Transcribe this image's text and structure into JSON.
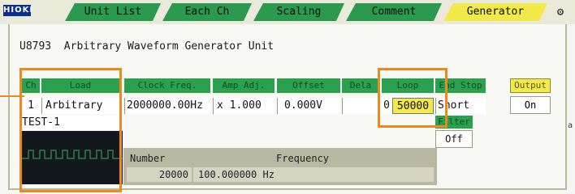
{
  "tabs": {
    "logo": "HIOKI",
    "items": [
      {
        "label": "Unit List"
      },
      {
        "label": "Each Ch"
      },
      {
        "label": "Scaling"
      },
      {
        "label": "Comment"
      },
      {
        "label": "Generator",
        "active": true
      }
    ],
    "icon": "settings-icon"
  },
  "unit_title": "U8793  Arbitrary Waveform Generator Unit",
  "channel_table": {
    "headers": {
      "ch": "Ch",
      "load": "Load",
      "clock_freq": "Clock Freq.",
      "amp_adj": "Amp Adj.",
      "offset": "Offset",
      "delay": "Dela",
      "loop": "Loop",
      "end_stop": "End Stop"
    },
    "row": {
      "ch": "1",
      "load": "Arbitrary",
      "clock_freq": "2000000.00Hz",
      "amp_adj": "x 1.000",
      "offset": "0.000V",
      "delay": "",
      "loop_prefix": "0",
      "loop": "50000",
      "end_stop": "Short"
    },
    "file_name": "TEST-1"
  },
  "filter": {
    "label": "Filter",
    "value": "Off"
  },
  "output": {
    "label": "Output",
    "value": "On"
  },
  "freq_table": {
    "headers": {
      "number": "Number",
      "frequency": "Frequency"
    },
    "row": {
      "number": "20000",
      "frequency": "100.000000 Hz"
    }
  },
  "side_text": "a",
  "colors": {
    "tab_green": "#2c9a4e",
    "tab_active": "#f2e94a",
    "header_green": "#2aa14e",
    "highlight_orange": "#ec8a22",
    "waveform_bg": "#12181b",
    "waveform_trace": "#2e7a57"
  }
}
